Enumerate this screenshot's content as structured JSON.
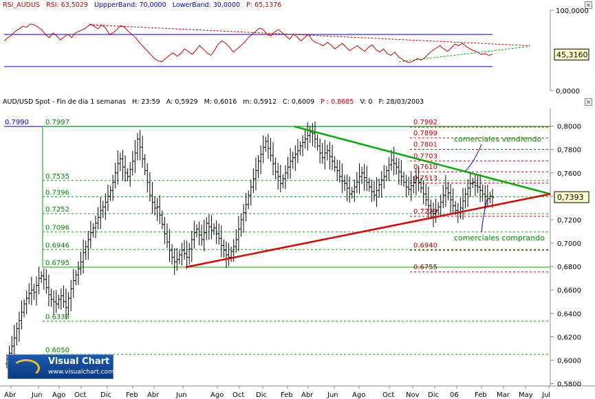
{
  "rsi_header": {
    "name": "RSI_AUDUS",
    "rsi": "RSI: 63,5029",
    "upper": "UppperBand: 70,0000",
    "lower": "LowerBand: 30,0000",
    "p": "P: 65,1376"
  },
  "price_header": {
    "symbol": "AUD/USD Spot - Fin de día 1 semanas",
    "h": "H: 23:59",
    "a": "A: 0,5929",
    "m_max": "M: 0,6016",
    "m_min": "m: 0,5912",
    "c": "C: 0,6009",
    "p": "P : 0,8685",
    "v": "V: 0",
    "f": "F: 28/03/2003"
  },
  "colors": {
    "rsi_line": "#cc0000",
    "band": "#0000cc",
    "resistance": "#00aa00",
    "support": "#dd0000",
    "fib_label": "#cc0000",
    "green_label": "#008800",
    "bar": "#000000"
  },
  "logo": {
    "brand": "Visual Chart",
    "url": "www.visualchart.com"
  },
  "chart_data": [
    {
      "type": "line",
      "title": "RSI_AUDUS",
      "ylim": [
        0,
        100
      ],
      "y_ticks": [
        "100,0000",
        "0,0000"
      ],
      "bands": [
        70,
        30
      ],
      "current_value_label": "45,3160",
      "series": [
        {
          "name": "RSI",
          "values": [
            62,
            66,
            69,
            74,
            77,
            80,
            79,
            83,
            82,
            79,
            76,
            70,
            66,
            72,
            68,
            63,
            67,
            70,
            66,
            72,
            74,
            76,
            79,
            83,
            80,
            77,
            82,
            78,
            70,
            72,
            76,
            81,
            79,
            74,
            70,
            66,
            60,
            55,
            50,
            45,
            40,
            37,
            36,
            40,
            44,
            47,
            43,
            46,
            52,
            49,
            45,
            50,
            56,
            52,
            47,
            44,
            50,
            58,
            62,
            59,
            54,
            48,
            52,
            56,
            60,
            66,
            70,
            74,
            78,
            76,
            70,
            68,
            73,
            76,
            72,
            68,
            64,
            70,
            67,
            62,
            66,
            70,
            63,
            60,
            58,
            56,
            60,
            57,
            52,
            55,
            59,
            54,
            50,
            53,
            56,
            52,
            49,
            54,
            57,
            51,
            48,
            52,
            46,
            44,
            48,
            42,
            39,
            36,
            35,
            37,
            40,
            38,
            41,
            46,
            50,
            53,
            56,
            52,
            49,
            53,
            58,
            56,
            59,
            55,
            52,
            50,
            48,
            45,
            46,
            44,
            45
          ]
        }
      ],
      "trendlines": [
        "resistance",
        "support"
      ]
    },
    {
      "type": "candlestick",
      "ylim": [
        0.578,
        0.808
      ],
      "y_ticks": [
        "0,8000",
        "0,7800",
        "0,7600",
        "0,7400",
        "0,7200",
        "0,7000",
        "0,6800",
        "0,6600",
        "0,6400",
        "0,6200",
        "0,6000",
        "0,5800"
      ],
      "y_tick_values": [
        0.8,
        0.78,
        0.76,
        0.74,
        0.72,
        0.7,
        0.68,
        0.66,
        0.64,
        0.62,
        0.6,
        0.58
      ],
      "x_ticks": [
        "Abr",
        "Jun",
        "Ago",
        "Oct",
        "Dic",
        "Feb",
        "Abr",
        "Jun",
        "Ago",
        "Oct",
        "Dic",
        "Feb",
        "Abr",
        "Jun",
        "Ago",
        "Oct",
        "Nov",
        "Dic",
        "06",
        "Feb",
        "Mar",
        "May",
        "Jul"
      ],
      "current_price_label": "0,7393",
      "left_level_label": "0.7990",
      "fib_left": [
        {
          "label": "0.7997",
          "value": 0.7997
        },
        {
          "label": "0.7535",
          "value": 0.7535
        },
        {
          "label": "0.7396",
          "value": 0.7396
        },
        {
          "label": "0.7252",
          "value": 0.7252
        },
        {
          "label": "0.7096",
          "value": 0.7096
        },
        {
          "label": "0.6946",
          "value": 0.6946
        },
        {
          "label": "0.6795",
          "value": 0.6795
        },
        {
          "label": "0.6333",
          "value": 0.6333
        },
        {
          "label": "0.6050",
          "value": 0.605
        }
      ],
      "fib_right": [
        {
          "label": "0.7992",
          "value": 0.7992
        },
        {
          "label": "0.7899",
          "value": 0.7899
        },
        {
          "label": "0.7801",
          "value": 0.7801
        },
        {
          "label": "0.7703",
          "value": 0.7703
        },
        {
          "label": "0.7610",
          "value": 0.761
        },
        {
          "label": "0.7513",
          "value": 0.7513
        },
        {
          "label": "0.7229",
          "value": 0.7229
        },
        {
          "label": "0.6940",
          "value": 0.694
        },
        {
          "label": "0.6755",
          "value": 0.6755
        }
      ],
      "annotations": [
        "comerciales vendiendo",
        "comerciales comprando"
      ],
      "resistance_line": [
        [
          0.7997,
          0.742
        ]
      ],
      "support_line": [
        [
          0.6795,
          0.742
        ]
      ],
      "closes": [
        0.601,
        0.606,
        0.612,
        0.619,
        0.627,
        0.634,
        0.641,
        0.648,
        0.653,
        0.657,
        0.66,
        0.658,
        0.664,
        0.67,
        0.672,
        0.669,
        0.662,
        0.656,
        0.652,
        0.65,
        0.648,
        0.652,
        0.655,
        0.65,
        0.645,
        0.653,
        0.661,
        0.668,
        0.673,
        0.678,
        0.684,
        0.692,
        0.697,
        0.703,
        0.709,
        0.713,
        0.717,
        0.722,
        0.728,
        0.731,
        0.735,
        0.74,
        0.745,
        0.752,
        0.76,
        0.768,
        0.772,
        0.765,
        0.76,
        0.757,
        0.763,
        0.77,
        0.777,
        0.789,
        0.782,
        0.772,
        0.762,
        0.752,
        0.741,
        0.735,
        0.73,
        0.731,
        0.724,
        0.716,
        0.708,
        0.701,
        0.694,
        0.688,
        0.684,
        0.686,
        0.69,
        0.694,
        0.691,
        0.688,
        0.695,
        0.703,
        0.709,
        0.712,
        0.707,
        0.703,
        0.709,
        0.717,
        0.714,
        0.711,
        0.713,
        0.708,
        0.704,
        0.698,
        0.694,
        0.69,
        0.688,
        0.693,
        0.697,
        0.703,
        0.712,
        0.72,
        0.726,
        0.733,
        0.741,
        0.748,
        0.755,
        0.762,
        0.77,
        0.776,
        0.782,
        0.787,
        0.781,
        0.775,
        0.768,
        0.761,
        0.757,
        0.751,
        0.755,
        0.76,
        0.765,
        0.77,
        0.773,
        0.776,
        0.779,
        0.783,
        0.786,
        0.789,
        0.792,
        0.795,
        0.794,
        0.789,
        0.783,
        0.777,
        0.773,
        0.777,
        0.779,
        0.774,
        0.77,
        0.765,
        0.762,
        0.757,
        0.753,
        0.751,
        0.747,
        0.742,
        0.744,
        0.748,
        0.752,
        0.757,
        0.76,
        0.756,
        0.752,
        0.748,
        0.744,
        0.741,
        0.745,
        0.75,
        0.754,
        0.757,
        0.762,
        0.767,
        0.771,
        0.768,
        0.765,
        0.761,
        0.757,
        0.752,
        0.748,
        0.746,
        0.749,
        0.752,
        0.756,
        0.752,
        0.747,
        0.742,
        0.737,
        0.732,
        0.727,
        0.725,
        0.728,
        0.731,
        0.735,
        0.741,
        0.747,
        0.743,
        0.737,
        0.732,
        0.728,
        0.726,
        0.73,
        0.736,
        0.742,
        0.747,
        0.751,
        0.752,
        0.749,
        0.748,
        0.745,
        0.742,
        0.74,
        0.738,
        0.74,
        0.739
      ]
    }
  ]
}
